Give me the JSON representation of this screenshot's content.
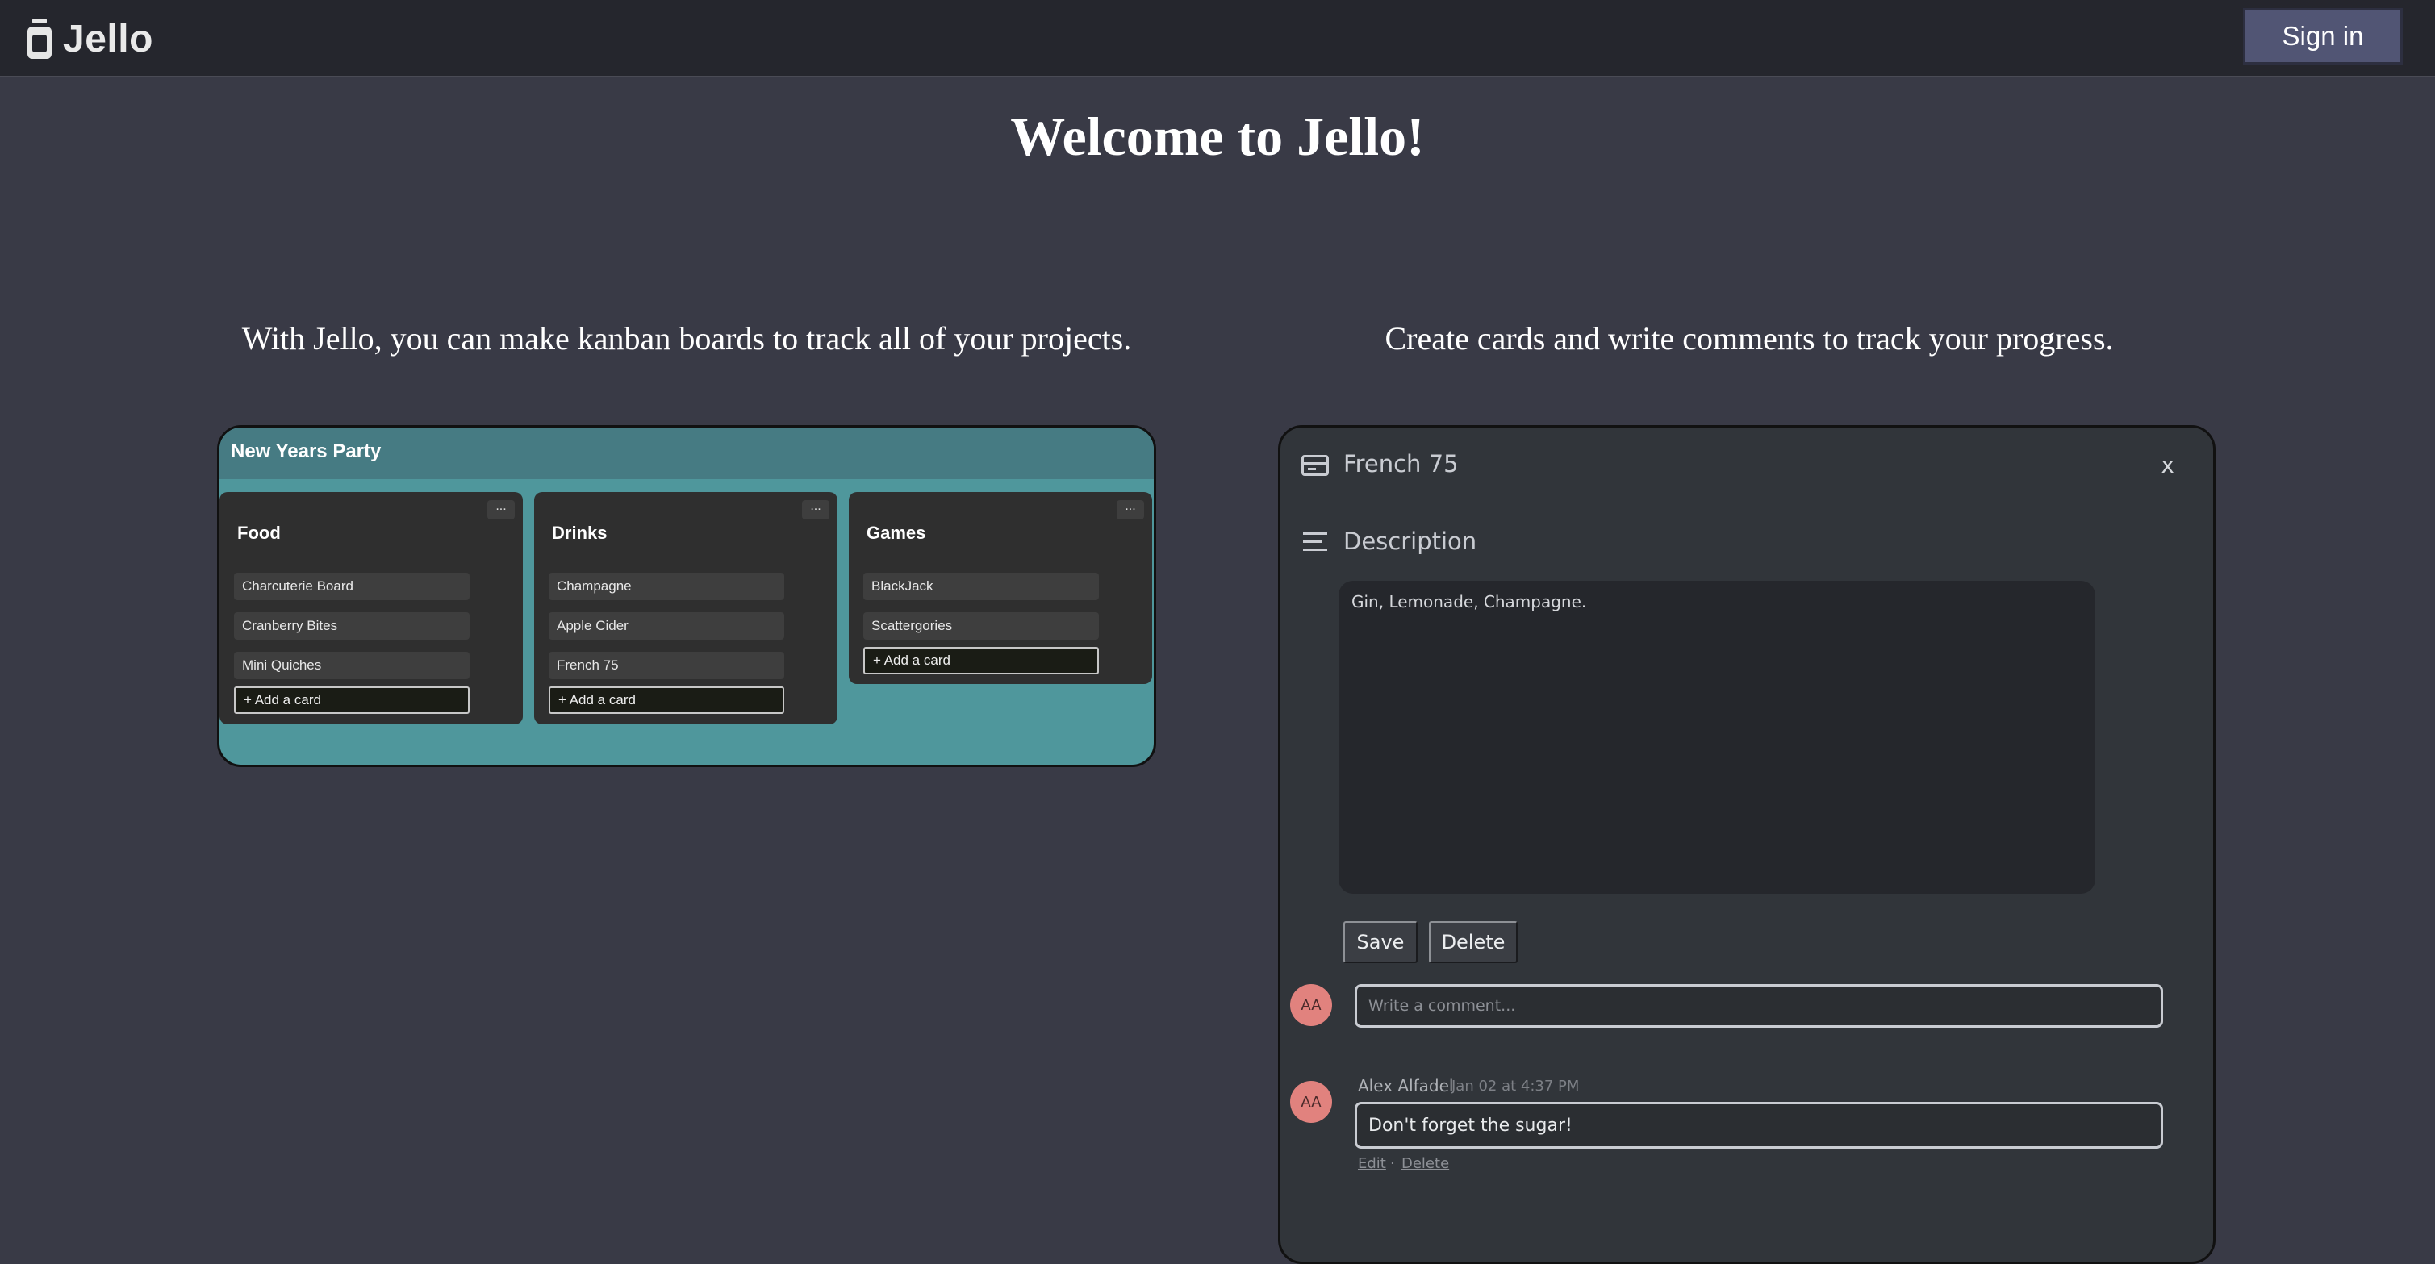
{
  "navbar": {
    "brand": "Jello",
    "sign_in_label": "Sign in"
  },
  "hero": {
    "title": "Welcome to Jello!",
    "left_blurb": "With Jello, you can make kanban boards to track all of your projects.",
    "right_blurb": "Create cards and write comments to track your progress."
  },
  "board_preview": {
    "title": "New Years Party",
    "lists": [
      {
        "title": "Food",
        "menu": "...",
        "cards": [
          "Charcuterie Board",
          "Cranberry Bites",
          "Mini Quiches"
        ],
        "add_label": "+ Add a card"
      },
      {
        "title": "Drinks",
        "menu": "...",
        "cards": [
          "Champagne",
          "Apple Cider",
          "French 75"
        ],
        "add_label": "+ Add a card"
      },
      {
        "title": "Games",
        "menu": "...",
        "cards": [
          "BlackJack",
          "Scattergories"
        ],
        "add_label": "+ Add a card"
      }
    ]
  },
  "card_preview": {
    "title": "French 75",
    "close_label": "x",
    "description_heading": "Description",
    "description_text": "Gin, Lemonade, Champagne.",
    "save_label": "Save",
    "delete_label": "Delete",
    "avatar_initials": "AA",
    "comment_placeholder": "Write a comment...",
    "comment": {
      "author": "Alex Alfadel",
      "time": "Jan 02 at 4:37 PM",
      "text": "Don't forget the sugar!",
      "edit_label": "Edit",
      "separator": "·",
      "delete_label": "Delete"
    }
  },
  "colors": {
    "page_background": "#393a46",
    "navbar_background": "#25262d",
    "sign_in_button": "#515574",
    "board_background": "#4f979c",
    "avatar": "#e1827e"
  }
}
